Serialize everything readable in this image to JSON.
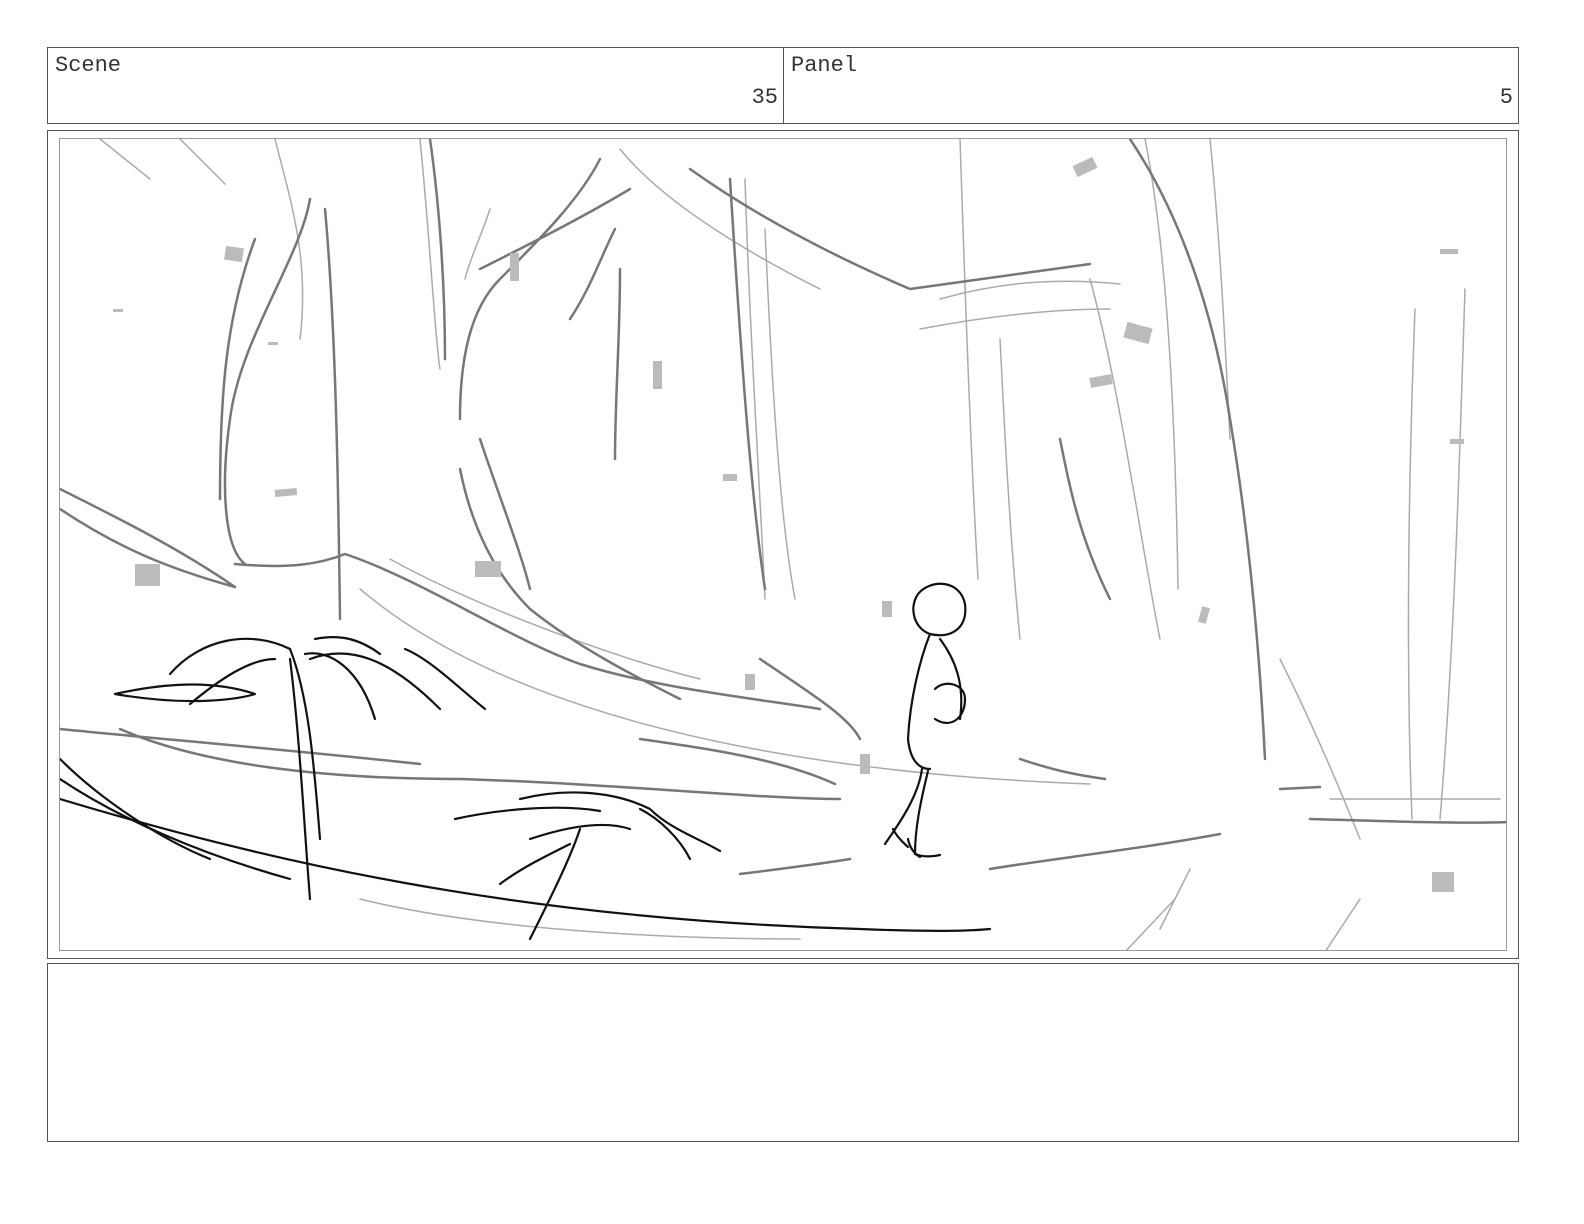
{
  "header": {
    "scene_label": "Scene",
    "scene_number": "35",
    "panel_label": "Panel",
    "panel_number": "5"
  },
  "colors": {
    "border": "#555555",
    "sketch_dark": "#111111",
    "sketch_mid": "#777777",
    "sketch_light": "#aaaaaa",
    "leaf": "#bbbbbb"
  },
  "illustration": {
    "icon": "storyboard-sketch-forest-child-icon"
  },
  "notes": {
    "text": ""
  }
}
